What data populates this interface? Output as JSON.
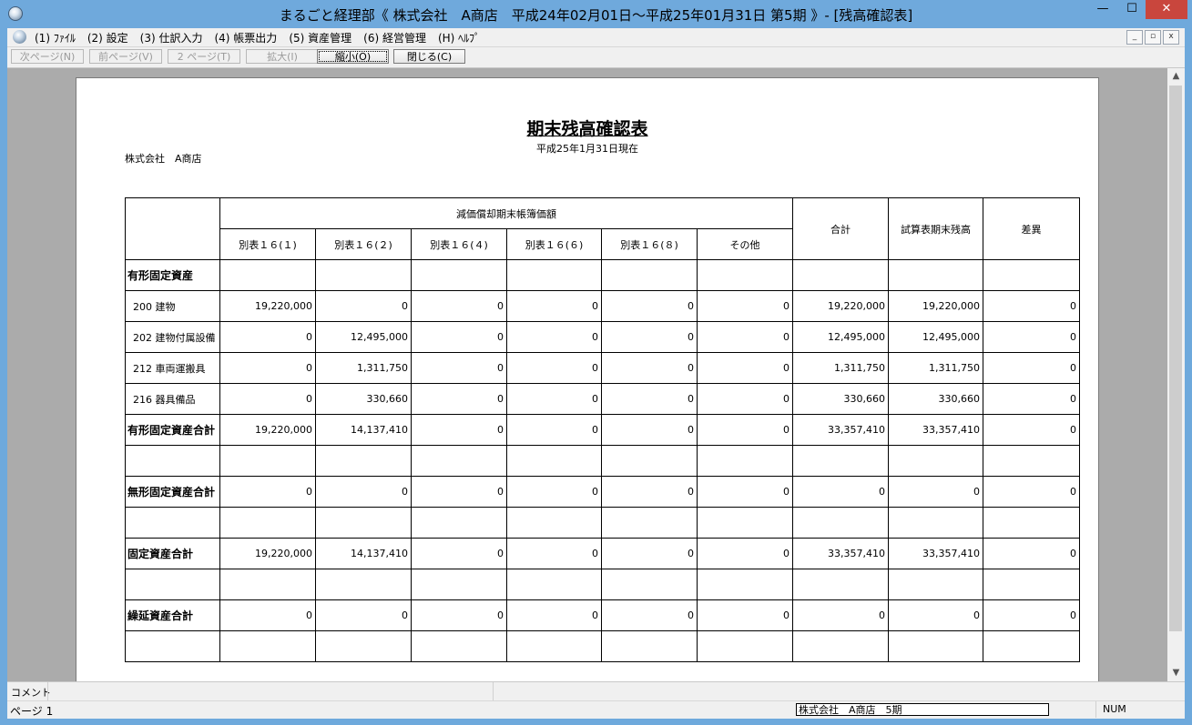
{
  "window": {
    "title": "まるごと経理部《 株式会社　A商店　平成24年02月01日～平成25年01月31日 第5期 》- [残高確認表]",
    "minimize": "—",
    "maximize": "☐",
    "close": "✕"
  },
  "menu": {
    "items": [
      "(1) ﾌｧｲﾙ",
      "(2) 設定",
      "(3) 仕訳入力",
      "(4) 帳票出力",
      "(5) 資産管理",
      "(6) 経営管理",
      "(H) ﾍﾙﾌﾟ"
    ],
    "mdi_min": "_",
    "mdi_restore": "▫",
    "mdi_close": "x"
  },
  "toolbar": {
    "next_page": "次ページ(N)",
    "prev_page": "前ページ(V)",
    "page_jump": "2 ページ(T)",
    "zoom_in": "拡大(I)",
    "zoom_out": "縮小(O)",
    "close": "閉じる(C)"
  },
  "report": {
    "title": "期末残高確認表",
    "date": "平成25年1月31日現在",
    "company": "株式会社　A商店",
    "header_group": "減価償却期末帳簿価額",
    "columns": [
      "別表１６(１)",
      "別表１６(２)",
      "別表１６(４)",
      "別表１６(６)",
      "別表１６(８)",
      "その他"
    ],
    "total_col": "合計",
    "trial_col": "試算表期末残高",
    "diff_col": "差異",
    "rows": [
      {
        "label": "有形固定資産",
        "type": "sec",
        "values": [
          "",
          "",
          "",
          "",
          "",
          "",
          "",
          "",
          ""
        ]
      },
      {
        "label": "200  建物",
        "type": "item",
        "values": [
          "19,220,000",
          "0",
          "0",
          "0",
          "0",
          "0",
          "19,220,000",
          "19,220,000",
          "0"
        ]
      },
      {
        "label": "202  建物付属設備",
        "type": "item",
        "values": [
          "0",
          "12,495,000",
          "0",
          "0",
          "0",
          "0",
          "12,495,000",
          "12,495,000",
          "0"
        ]
      },
      {
        "label": "212  車両運搬具",
        "type": "item",
        "values": [
          "0",
          "1,311,750",
          "0",
          "0",
          "0",
          "0",
          "1,311,750",
          "1,311,750",
          "0"
        ]
      },
      {
        "label": "216  器具備品",
        "type": "item",
        "values": [
          "0",
          "330,660",
          "0",
          "0",
          "0",
          "0",
          "330,660",
          "330,660",
          "0"
        ]
      },
      {
        "label": "有形固定資産合計",
        "type": "sec",
        "values": [
          "19,220,000",
          "14,137,410",
          "0",
          "0",
          "0",
          "0",
          "33,357,410",
          "33,357,410",
          "0"
        ]
      },
      {
        "label": "",
        "type": "blank",
        "values": [
          "",
          "",
          "",
          "",
          "",
          "",
          "",
          "",
          ""
        ]
      },
      {
        "label": "無形固定資産合計",
        "type": "sec",
        "values": [
          "0",
          "0",
          "0",
          "0",
          "0",
          "0",
          "0",
          "0",
          "0"
        ]
      },
      {
        "label": "",
        "type": "blank",
        "values": [
          "",
          "",
          "",
          "",
          "",
          "",
          "",
          "",
          ""
        ]
      },
      {
        "label": "固定資産合計",
        "type": "sec",
        "values": [
          "19,220,000",
          "14,137,410",
          "0",
          "0",
          "0",
          "0",
          "33,357,410",
          "33,357,410",
          "0"
        ]
      },
      {
        "label": "",
        "type": "blank",
        "values": [
          "",
          "",
          "",
          "",
          "",
          "",
          "",
          "",
          ""
        ]
      },
      {
        "label": "繰延資産合計",
        "type": "sec",
        "values": [
          "0",
          "0",
          "0",
          "0",
          "0",
          "0",
          "0",
          "0",
          "0"
        ]
      },
      {
        "label": "",
        "type": "blank",
        "values": [
          "",
          "",
          "",
          "",
          "",
          "",
          "",
          "",
          ""
        ]
      }
    ]
  },
  "status": {
    "comment_label": "コメント",
    "page": "ページ 1",
    "company_period": "株式会社　A商店　5期",
    "num": "NUM"
  }
}
